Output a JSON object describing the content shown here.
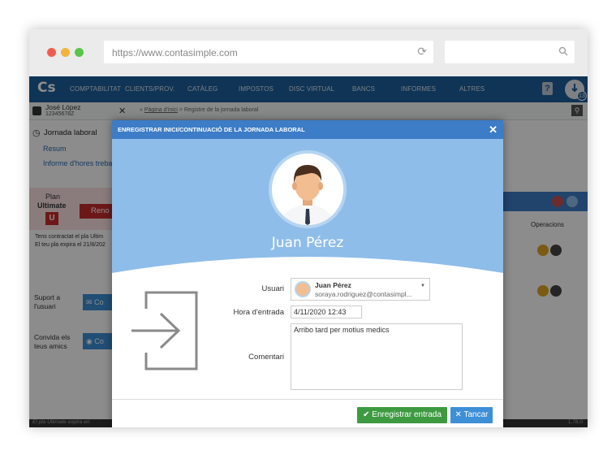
{
  "browser": {
    "url": "https://www.contasimple.com"
  },
  "nav": {
    "logo": "Cs",
    "items": [
      "COMPTABILITAT",
      "CLIENTS/PROV.",
      "CATÀLEG",
      "IMPOSTOS",
      "DISC VIRTUAL",
      "BANCS",
      "INFORMES",
      "ALTRES"
    ],
    "help": "?",
    "notifications": "13"
  },
  "subbar": {
    "user_name": "José López",
    "user_id": "12345678Z",
    "breadcrumb_home": "Pàgina d'inici",
    "breadcrumb_current": " > Registre de la jornada laboral"
  },
  "sidebar": {
    "section_title": "Jornada laboral",
    "links": [
      "Resum",
      "Informe d'hores treba"
    ],
    "plan_label": "Plan",
    "plan_name": "Ultimate",
    "plan_icon": "U",
    "renew_button": "Reno",
    "plan_info_1": "Tens contractat el pla Ultim",
    "plan_info_2": "El teu pla expira el 21/8/202",
    "support_label_1": "Suport a",
    "support_label_2": "l'usuari",
    "support_button": "Co",
    "invite_label_1": "Convida els",
    "invite_label_2": "teus amics",
    "invite_button": "Co",
    "footer_text": "El pla Ultimate expira en"
  },
  "table": {
    "col_header": "Operacions"
  },
  "version": "1.78.0",
  "modal": {
    "title": "ENREGISTRAR INICI/CONTINUACIÓ DE LA JORNADA LABORAL",
    "close": "✕",
    "hero_name": "Juan Pérez",
    "user_label": "Usuari",
    "user_name": "Juan Pérez",
    "user_email": "soraya.rodriguez@contasimpl...",
    "time_label": "Hora d'entrada",
    "time_value": "4/11/2020 12:43",
    "comment_label": "Comentari",
    "comment_value": "Arribo tard per motius medics",
    "save_button": "Enregistrar entrada",
    "cancel_button": "Tancar"
  },
  "colors": {
    "nav": "#1c5f9b",
    "modal_header": "#3d7cc6",
    "hero": "#8fbde9",
    "save": "#3d9a40",
    "cancel": "#3d8fd6"
  }
}
